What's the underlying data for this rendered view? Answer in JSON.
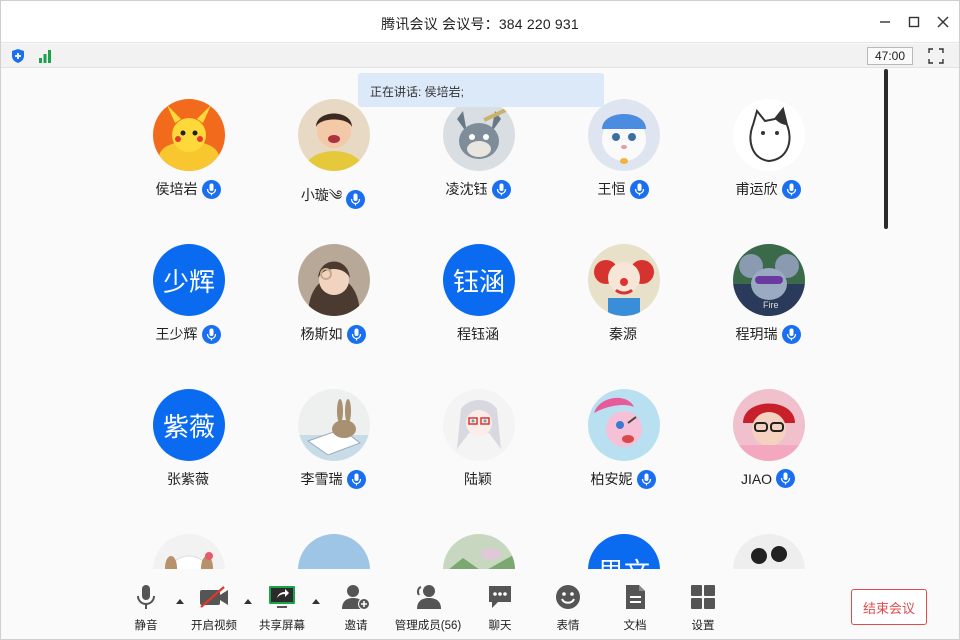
{
  "window": {
    "title": "腾讯会议 会议号：384 220 931",
    "minimize_icon": "minimize-icon",
    "maximize_icon": "maximize-icon",
    "close_icon": "close-icon"
  },
  "statusbar": {
    "timer": "47:00",
    "icons": [
      "shield-icon",
      "signal-icon",
      "fullscreen-icon"
    ]
  },
  "speaking": {
    "text": "正在讲话: 侯培岩;"
  },
  "participants": [
    {
      "name": "侯培岩",
      "avatar_type": "image",
      "avatar_desc": "pikachu",
      "mic": true
    },
    {
      "name": "小璇༄",
      "avatar_type": "image",
      "avatar_desc": "child",
      "mic": true
    },
    {
      "name": "凌沈钰",
      "avatar_type": "image",
      "avatar_desc": "tom-cat",
      "mic": true
    },
    {
      "name": "王恒",
      "avatar_type": "image",
      "avatar_desc": "white-kitten",
      "mic": true
    },
    {
      "name": "甫运欣",
      "avatar_type": "image",
      "avatar_desc": "cat-sketch",
      "mic": true
    },
    {
      "name": "王少辉",
      "avatar_type": "text",
      "avatar_text": "少辉",
      "mic": true
    },
    {
      "name": "杨斯如",
      "avatar_type": "image",
      "avatar_desc": "girl",
      "mic": true
    },
    {
      "name": "程钰涵",
      "avatar_type": "text",
      "avatar_text": "钰涵",
      "mic": false
    },
    {
      "name": "秦源",
      "avatar_type": "image",
      "avatar_desc": "clown",
      "mic": false
    },
    {
      "name": "程玥瑞",
      "avatar_type": "image",
      "avatar_desc": "cartoon-mouse",
      "mic": true
    },
    {
      "name": "张紫薇",
      "avatar_type": "text",
      "avatar_text": "紫薇",
      "mic": false
    },
    {
      "name": "李雪瑞",
      "avatar_type": "image",
      "avatar_desc": "rabbit",
      "mic": true
    },
    {
      "name": "陆颖",
      "avatar_type": "image",
      "avatar_desc": "anime-girl",
      "mic": false
    },
    {
      "name": "柏安妮",
      "avatar_type": "image",
      "avatar_desc": "pink-pony",
      "mic": true
    },
    {
      "name": "JIAO",
      "avatar_type": "image",
      "avatar_desc": "baby",
      "mic": true
    },
    {
      "name": "",
      "avatar_type": "image",
      "avatar_desc": "dog",
      "mic": false
    },
    {
      "name": "",
      "avatar_type": "image",
      "avatar_desc": "sky",
      "mic": false
    },
    {
      "name": "",
      "avatar_type": "image",
      "avatar_desc": "landscape",
      "mic": false
    },
    {
      "name": "",
      "avatar_type": "text",
      "avatar_text": "思文",
      "mic": false
    },
    {
      "name": "",
      "avatar_type": "image",
      "avatar_desc": "silhouette",
      "mic": false
    }
  ],
  "toolbar": {
    "mute_label": "静音",
    "video_label": "开启视频",
    "share_label": "共享屏幕",
    "invite_label": "邀请",
    "members_label": "管理成员(56)",
    "chat_label": "聊天",
    "emoji_label": "表情",
    "docs_label": "文档",
    "settings_label": "设置",
    "end_label": "结束会议"
  },
  "colors": {
    "accent": "#1a6ff0",
    "text_avatar_bg": "#0a6bf0",
    "end_button": "#e24b4b",
    "speaking_bg": "#dce9f8",
    "share_green": "#1aa34a",
    "video_off_red": "#e0392b"
  }
}
